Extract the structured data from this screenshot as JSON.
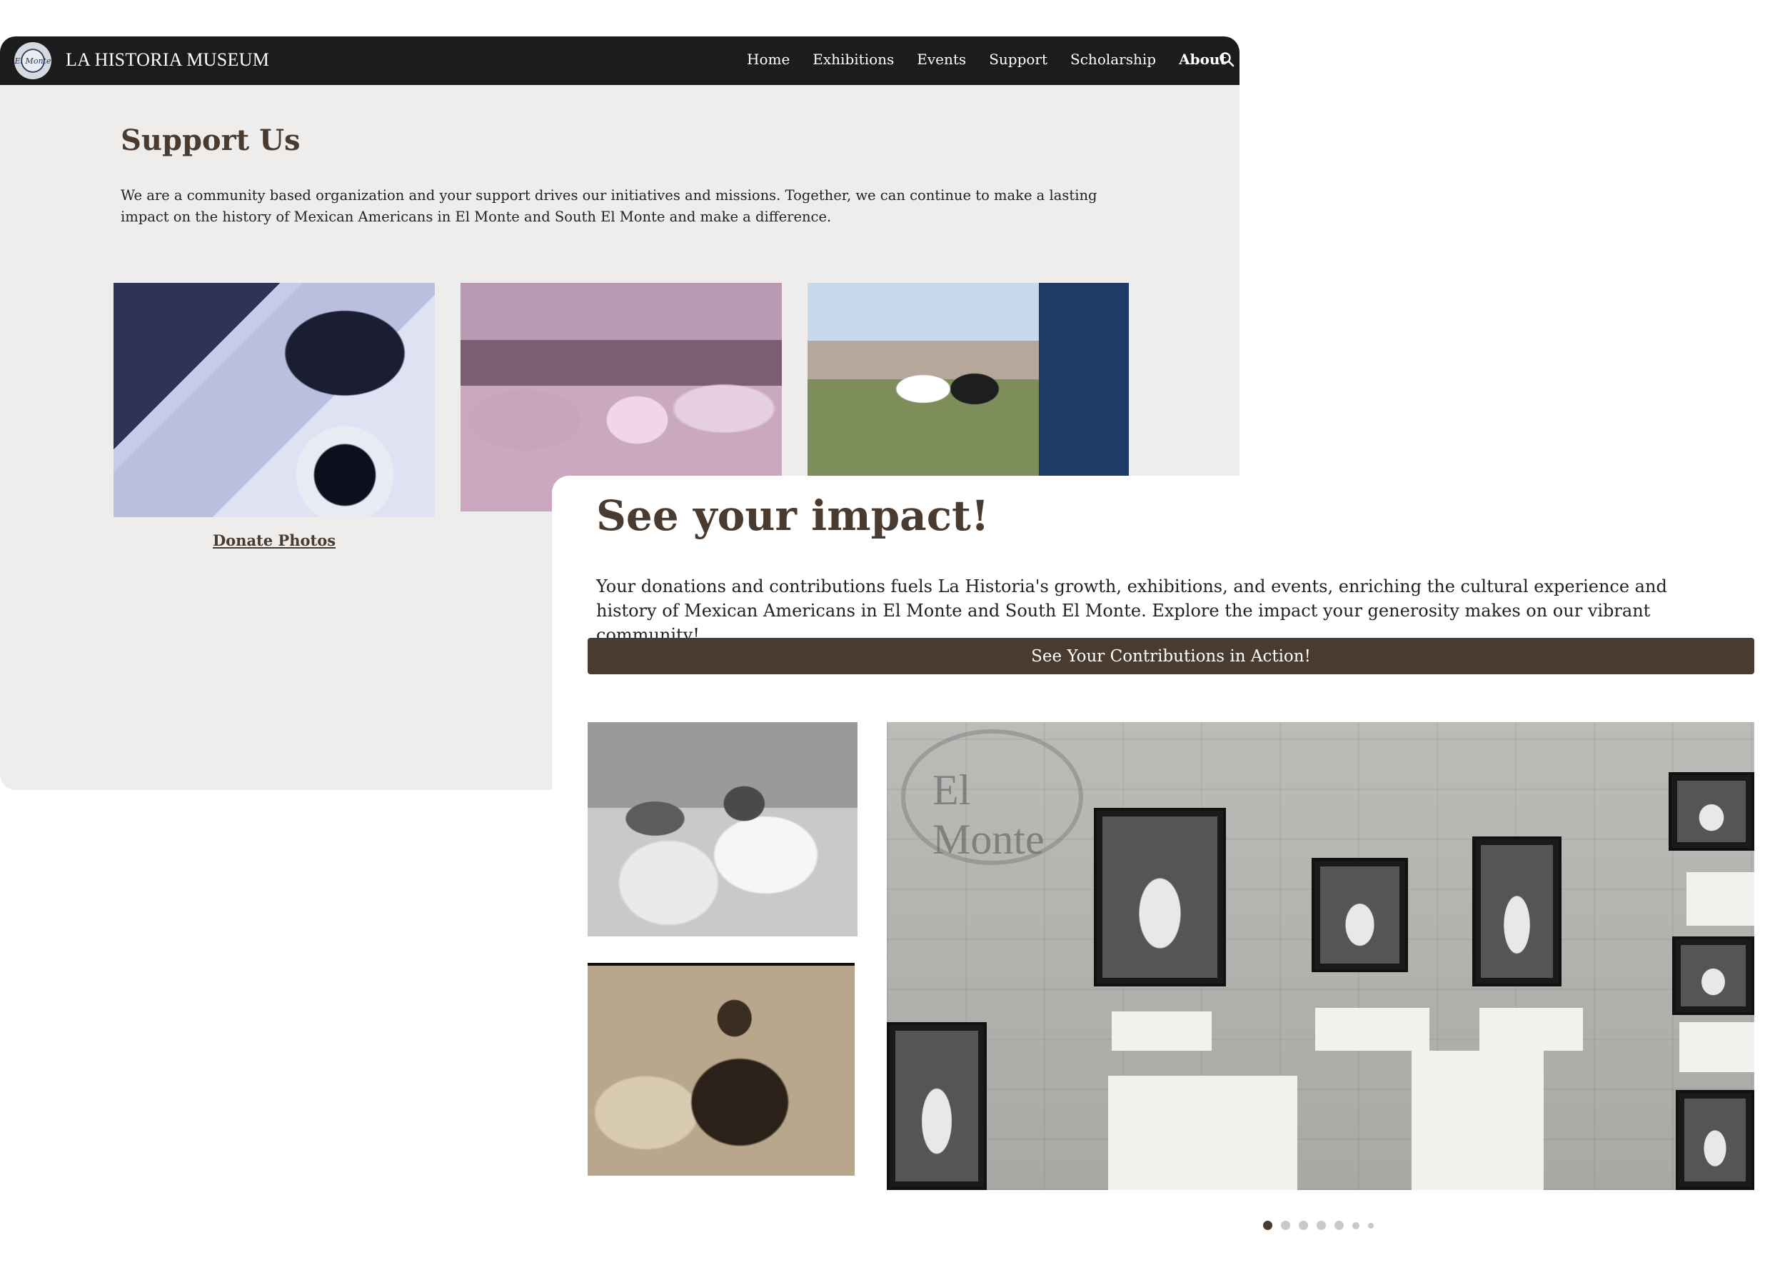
{
  "site": {
    "title": "LA HISTORIA MUSEUM",
    "logo_text": "El Monte"
  },
  "nav": {
    "items": [
      {
        "label": "Home"
      },
      {
        "label": "Exhibitions"
      },
      {
        "label": "Events"
      },
      {
        "label": "Support"
      },
      {
        "label": "Scholarship"
      },
      {
        "label": "About",
        "active": true
      }
    ],
    "search_icon": "search-icon"
  },
  "support": {
    "heading": "Support Us",
    "text": "We are a community based organization and your support drives our initiatives and missions. Together, we can continue to make a lasting impact on the history of Mexican Americans in El Monte and South El Monte and make a difference.",
    "cards": [
      {
        "label": "Donate Photos"
      },
      {
        "label": ""
      },
      {
        "label": ""
      }
    ]
  },
  "impact": {
    "heading": "See your impact!",
    "text": "Your donations and contributions fuels La Historia's growth, exhibitions, and events, enriching the cultural experience and history of Mexican Americans in El Monte and South El Monte. Explore the impact your generosity makes on our vibrant community!",
    "button_label": "See Your Contributions in Action!",
    "stamp_text": "El Monte",
    "carousel": {
      "total": 7,
      "active_index": 0
    }
  },
  "colors": {
    "accent": "#4a3b31",
    "navbar": "#1c1c1c",
    "page_bg": "#efedeb"
  }
}
